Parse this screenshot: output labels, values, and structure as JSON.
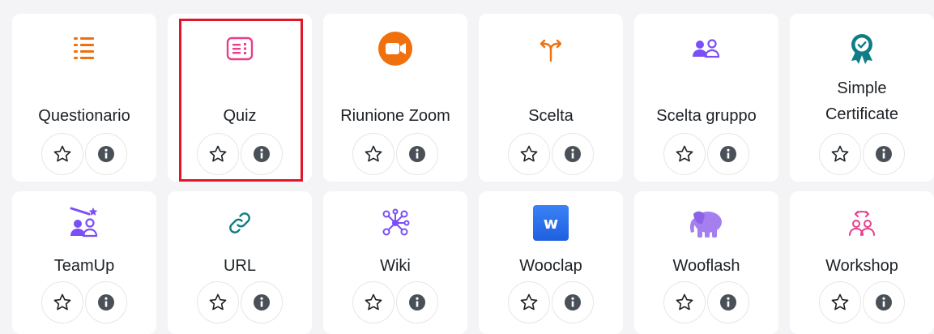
{
  "activities": [
    {
      "name": "Questionario",
      "icon": "questionnaire-icon",
      "color": "#f0700d"
    },
    {
      "name": "Quiz",
      "icon": "quiz-icon",
      "color": "#e83e8c"
    },
    {
      "name": "Riunione Zoom",
      "icon": "zoom-camera-icon",
      "color": "#f0700d"
    },
    {
      "name": "Scelta",
      "icon": "choice-arrows-icon",
      "color": "#f0700d"
    },
    {
      "name": "Scelta gruppo",
      "icon": "group-choice-icon",
      "color": "#7a4ff5"
    },
    {
      "name": "Simple Certificate",
      "icon": "certificate-ribbon-icon",
      "color": "#0f7d85"
    },
    {
      "name": "TeamUp",
      "icon": "teamup-icon",
      "color": "#7a4ff5"
    },
    {
      "name": "URL",
      "icon": "link-icon",
      "color": "#0f7d85"
    },
    {
      "name": "Wiki",
      "icon": "wiki-icon",
      "color": "#7a4ff5"
    },
    {
      "name": "Wooclap",
      "icon": "wooclap-icon",
      "color": "#2f6fed",
      "badge": "w"
    },
    {
      "name": "Wooflash",
      "icon": "elephant-icon",
      "color": "#a57ff0"
    },
    {
      "name": "Workshop",
      "icon": "workshop-icon",
      "color": "#e83e8c"
    }
  ],
  "highlighted": "Quiz"
}
